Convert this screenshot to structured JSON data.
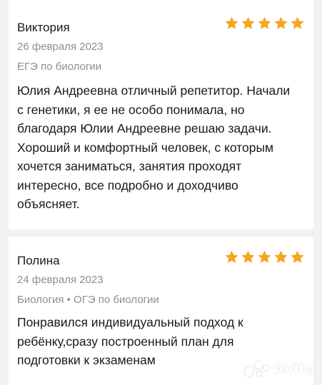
{
  "colors": {
    "star": "#f5a623",
    "text": "#1a1a1a",
    "muted": "#8e8e8e",
    "background": "#f2f2f2",
    "card": "#ffffff"
  },
  "reviews": [
    {
      "author": "Виктория",
      "rating": 5,
      "date": "26 февраля 2023",
      "subject": "ЕГЭ по биологии",
      "text": "Юлия Андреевна отличный репетитор. Начали с генетики, я ее не особо понимала, но благодаря Юлии Андреевне решаю задачи. Хороший и комфортный человек, с которым хочется заниматься, занятия проходят интересно, все подробно и доходчиво объясняет."
    },
    {
      "author": "Полина",
      "rating": 5,
      "date": "24 февраля 2023",
      "subject": "Биология • ОГЭ по биологии",
      "text": "Понравился индивидуальный подход к ребёнку,сразу построенный план для подготовки к экзаменам"
    }
  ],
  "watermark": {
    "text": "Avito",
    "icon": "avito-logo-icon"
  }
}
